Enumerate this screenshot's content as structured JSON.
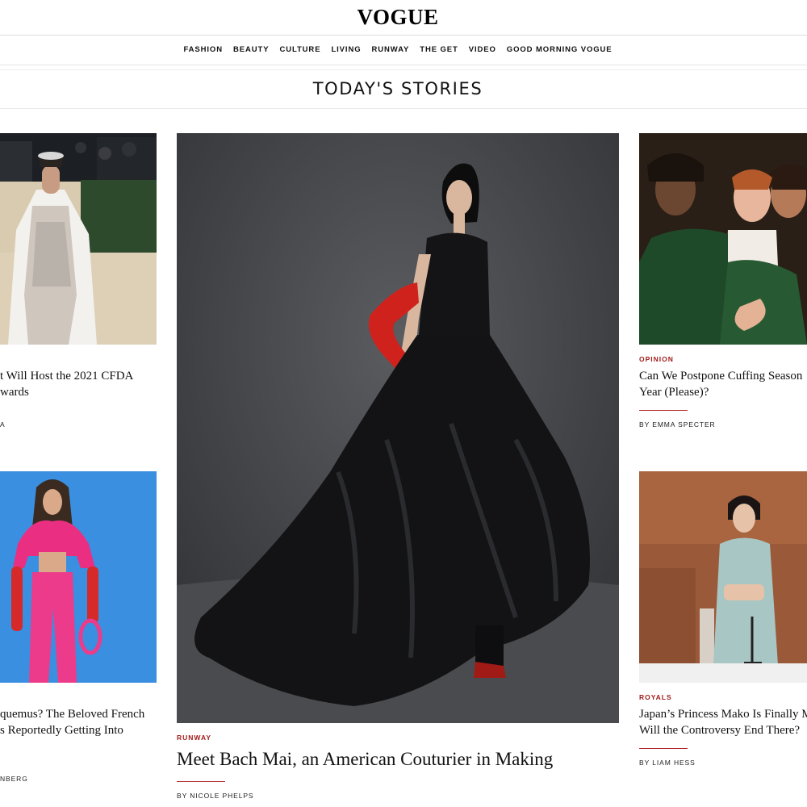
{
  "brand": {
    "logo_text": "VOGUE"
  },
  "nav": {
    "items": [
      "FASHION",
      "BEAUTY",
      "CULTURE",
      "LIVING",
      "RUNWAY",
      "THE GET",
      "VIDEO",
      "GOOD MORNING VOGUE"
    ]
  },
  "section": {
    "title": "TODAY'S STORIES"
  },
  "stories": {
    "left_top": {
      "headline": "t Will Host the 2021 CFDA\nwards",
      "byline": "A",
      "image_label": "Woman in embellished white caped gown on red carpet"
    },
    "left_bottom": {
      "headline": "quemus? The Beloved French\ns Reportedly Getting Into",
      "byline": "NBERG",
      "image_label": "Model in hot pink outfit with red gloves on blue background"
    },
    "center": {
      "category": "RUNWAY",
      "headline": "Meet Bach Mai, an American Couturier in Making",
      "byline": "BY NICOLE PHELPS",
      "image_label": "Model in black moiré gown with red gloves against gray backdrop"
    },
    "right_top": {
      "category": "OPINION",
      "headline": "Can We Postpone Cuffing Season\nYear (Please)?",
      "byline": "BY EMMA SPECTER",
      "image_label": "Renaissance painting of embracing couple"
    },
    "right_bottom": {
      "category": "ROYALS",
      "headline": "Japan’s Princess Mako Is Finally M\nWill the Controversy End There?",
      "byline": "BY LIAM HESS",
      "image_label": "Princess in pale blue dress at press conference"
    }
  },
  "colors": {
    "accent": "#a11b1b",
    "rule": "#dcdcdc",
    "text": "#111111"
  }
}
